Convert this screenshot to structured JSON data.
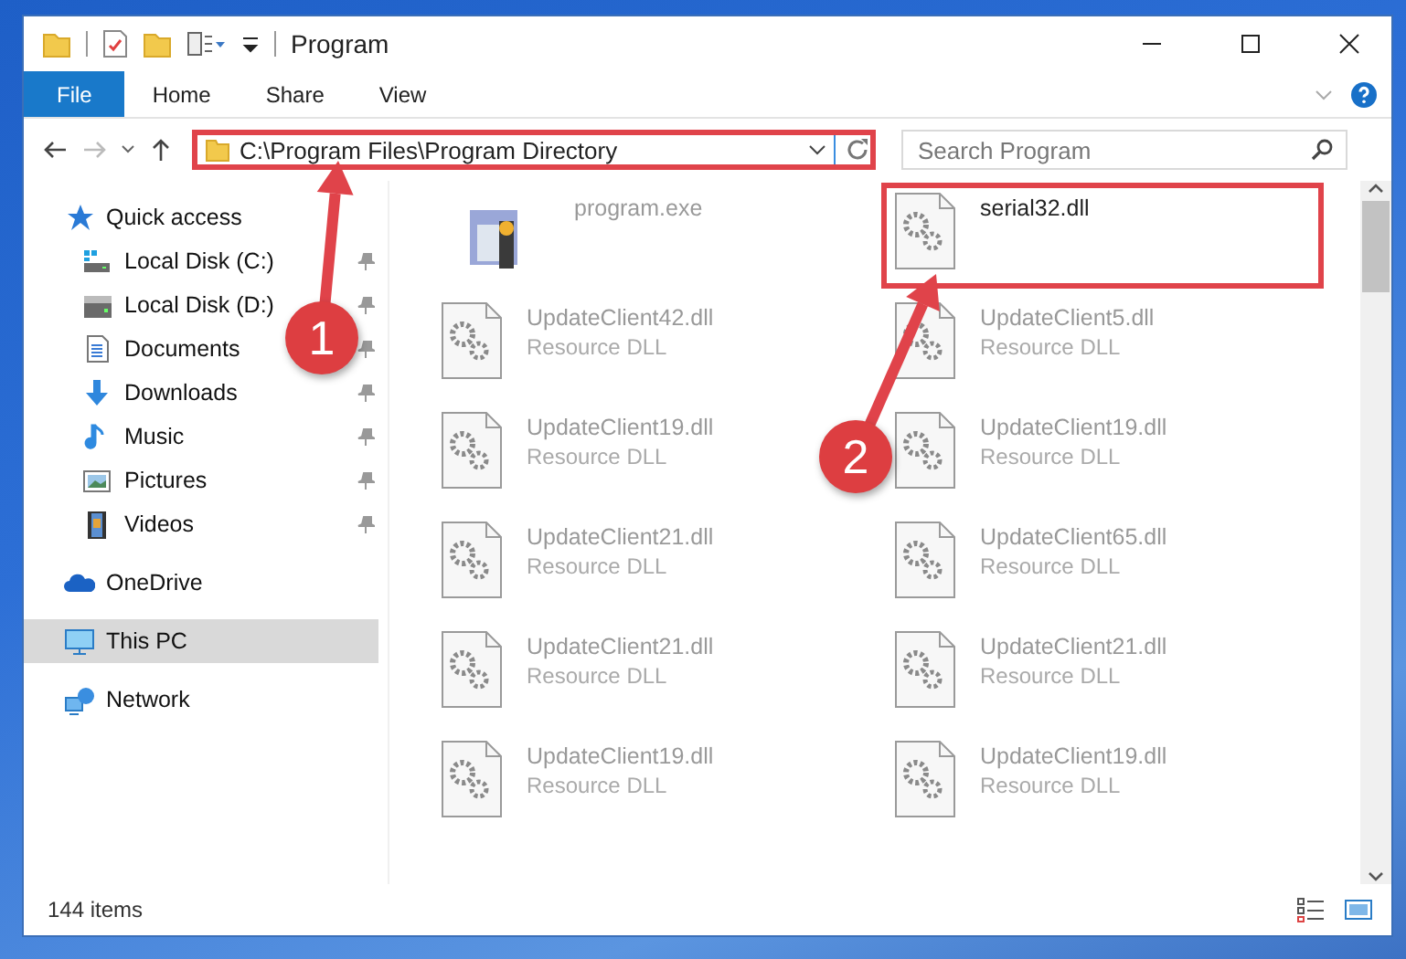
{
  "window": {
    "title": "Program"
  },
  "ribbon_tabs": [
    {
      "label": "File",
      "selected": true
    },
    {
      "label": "Home",
      "selected": false
    },
    {
      "label": "Share",
      "selected": false
    },
    {
      "label": "View",
      "selected": false
    }
  ],
  "address_bar": {
    "path": "C:\\Program Files\\Program Directory",
    "highlighted": true
  },
  "search": {
    "placeholder": "Search Program"
  },
  "sidebar": {
    "items": [
      {
        "label": "Quick access",
        "kind": "quick",
        "selected": false,
        "children": [
          {
            "label": "Local Disk (C:)",
            "kind": "system-drive",
            "pinned": true
          },
          {
            "label": "Local Disk (D:)",
            "kind": "drive",
            "pinned": true
          },
          {
            "label": "Documents",
            "kind": "documents",
            "pinned": true
          },
          {
            "label": "Downloads",
            "kind": "downloads",
            "pinned": true
          },
          {
            "label": "Music",
            "kind": "music",
            "pinned": true
          },
          {
            "label": "Pictures",
            "kind": "pictures",
            "pinned": true
          },
          {
            "label": "Videos",
            "kind": "videos",
            "pinned": true
          }
        ]
      },
      {
        "label": "OneDrive",
        "kind": "cloud",
        "selected": false
      },
      {
        "label": "This PC",
        "kind": "pc",
        "selected": true
      },
      {
        "label": "Network",
        "kind": "network",
        "selected": false
      }
    ]
  },
  "files": [
    {
      "name": "program.exe",
      "kind": "exe",
      "highlighted": false
    },
    {
      "name": "serial32.dll",
      "kind": "dll",
      "highlighted": true
    },
    {
      "name": "UpdateClient42.dll",
      "type": "Resource DLL",
      "kind": "dll",
      "highlighted": false
    },
    {
      "name": "UpdateClient5.dll",
      "type": "Resource DLL",
      "kind": "dll",
      "highlighted": false
    },
    {
      "name": "UpdateClient19.dll",
      "type": "Resource DLL",
      "kind": "dll",
      "highlighted": false
    },
    {
      "name": "UpdateClient19.dll",
      "type": "Resource DLL",
      "kind": "dll",
      "highlighted": false
    },
    {
      "name": "UpdateClient21.dll",
      "type": "Resource DLL",
      "kind": "dll",
      "highlighted": false
    },
    {
      "name": "UpdateClient65.dll",
      "type": "Resource DLL",
      "kind": "dll",
      "highlighted": false
    },
    {
      "name": "UpdateClient21.dll",
      "type": "Resource DLL",
      "kind": "dll",
      "highlighted": false
    },
    {
      "name": "UpdateClient21.dll",
      "type": "Resource DLL",
      "kind": "dll",
      "highlighted": false
    },
    {
      "name": "UpdateClient19.dll",
      "type": "Resource DLL",
      "kind": "dll",
      "highlighted": false
    },
    {
      "name": "UpdateClient19.dll",
      "type": "Resource DLL",
      "kind": "dll",
      "highlighted": false
    }
  ],
  "callouts": [
    {
      "number": "1"
    },
    {
      "number": "2"
    }
  ],
  "status_bar": {
    "item_count": "144 items"
  }
}
